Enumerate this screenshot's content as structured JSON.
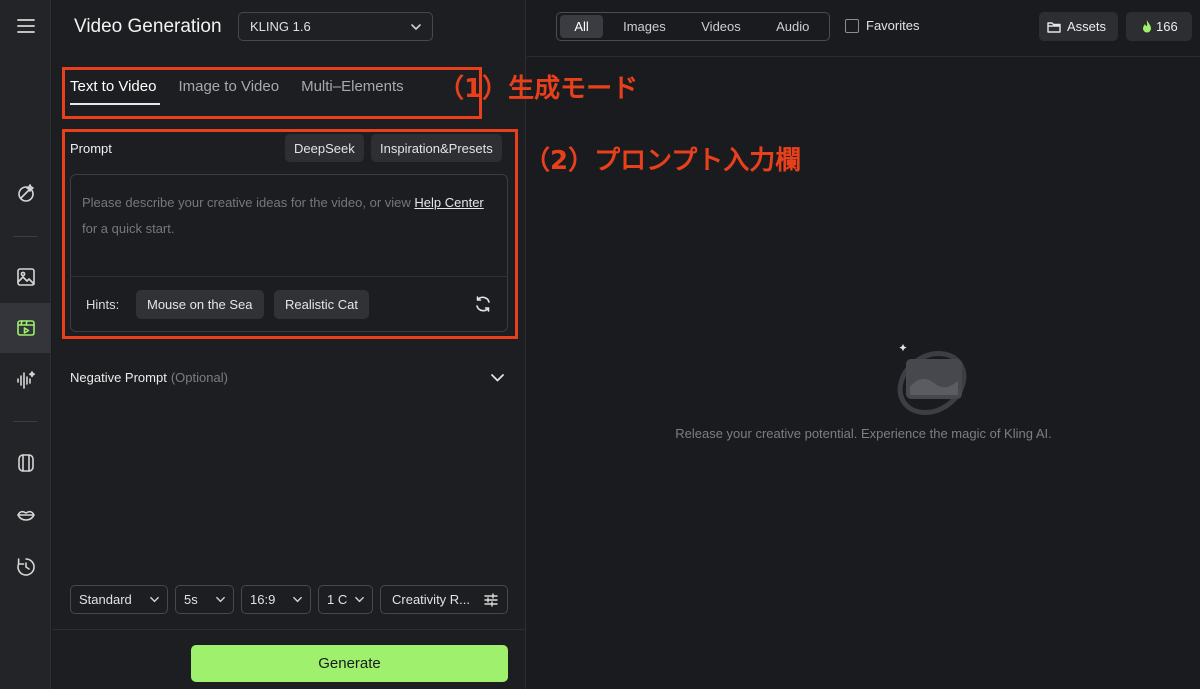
{
  "app": {
    "title": "Video Generation",
    "model": "KLING 1.6"
  },
  "sidebar": {
    "icons": [
      "menu-icon",
      "magic-wand-icon",
      "image-icon",
      "video-icon",
      "audio-wave-icon",
      "shirt-icon",
      "lips-icon",
      "history-icon"
    ],
    "active": "video-icon"
  },
  "tabs": [
    "Text to Video",
    "Image to Video",
    "Multi–Elements"
  ],
  "prompt": {
    "label": "Prompt",
    "deepseek_label": "DeepSeek",
    "presets_label": "Inspiration&Presets",
    "placeholder_pre": "Please describe your creative ideas for the video, or view ",
    "help_link": "Help Center",
    "placeholder_post": " for a quick start.",
    "hints_label": "Hints:",
    "hints": [
      "Mouse on the Sea",
      "Realistic Cat"
    ]
  },
  "negative_prompt": {
    "label": "Negative Prompt",
    "optional": "(Optional)"
  },
  "options": {
    "mode": "Standard",
    "duration": "5s",
    "aspect": "16:9",
    "count": "1 C",
    "creativity": "Creativity R..."
  },
  "generate_label": "Generate",
  "filters": [
    "All",
    "Images",
    "Videos",
    "Audio"
  ],
  "active_filter": "All",
  "favorites_label": "Favorites",
  "assets_label": "Assets",
  "credits": "166",
  "empty_message": "Release your creative potential. Experience the magic of Kling AI.",
  "annotations": {
    "mode": "（1）生成モード",
    "prompt": "（2）プロンプト入力欄"
  },
  "colors": {
    "accent": "#9ff06c",
    "annotation": "#e9401c",
    "background": "#1a1b1e"
  }
}
